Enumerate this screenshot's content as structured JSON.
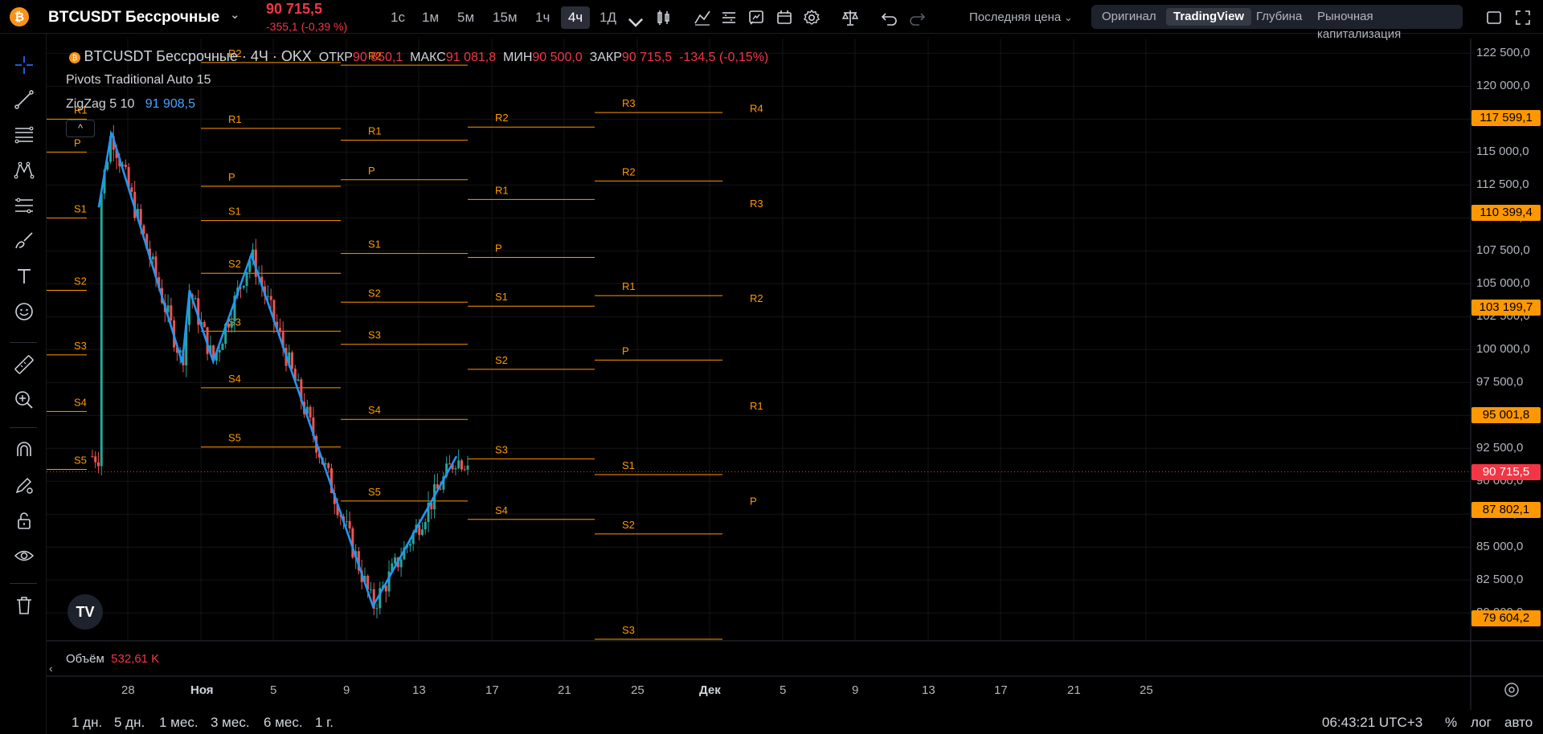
{
  "header": {
    "pair": "BTCUSDT Бессрочные",
    "last_price": "90 715,5",
    "change": "-355,1 (-0,39 %)",
    "timeframes": [
      "1с",
      "1м",
      "5м",
      "15м",
      "1ч",
      "4ч",
      "1Д"
    ],
    "active_timeframe": "4ч",
    "price_type": "Последняя цена",
    "views": [
      "Оригинал",
      "TradingView",
      "Глубина",
      "Рыночная капитализация"
    ],
    "active_view": "TradingView"
  },
  "legend": {
    "symbol": "BTCUSDT Бессрочные · 4Ч · OKX",
    "open_label": "ОТКР",
    "open": "90 850,1",
    "high_label": "МАКС",
    "high": "91 081,8",
    "low_label": "МИН",
    "low": "90 500,0",
    "close_label": "ЗАКР",
    "close": "90 715,5",
    "change": "-134,5 (-0,15%)",
    "pivots": "Pivots Traditional Auto 15",
    "zigzag": "ZigZag 5 10",
    "zigzag_value": "91 908,5",
    "collapse": "^"
  },
  "price_axis": {
    "ticks": [
      "122 500,0",
      "120 000,0",
      "117 500,0",
      "115 000,0",
      "112 500,0",
      "110 000,0",
      "107 500,0",
      "105 000,0",
      "102 500,0",
      "100 000,0",
      "97 500,0",
      "95 000,0",
      "92 500,0",
      "90 000,0",
      "87 500,0",
      "85 000,0",
      "82 500,0",
      "80 000,0"
    ],
    "badges": [
      {
        "text": "117 599,1",
        "price": 117599.1,
        "kind": "pivot"
      },
      {
        "text": "110 399,4",
        "price": 110399.4,
        "kind": "pivot"
      },
      {
        "text": "103 199,7",
        "price": 103199.7,
        "kind": "pivot"
      },
      {
        "text": "95 001,8",
        "price": 95001.8,
        "kind": "pivot"
      },
      {
        "text": "90 715,5",
        "price": 90715.5,
        "kind": "last"
      },
      {
        "text": "87 802,1",
        "price": 87802.1,
        "kind": "pivot"
      },
      {
        "text": "79 604,2",
        "price": 79604.2,
        "kind": "pivot"
      }
    ]
  },
  "time_axis": {
    "ticks": [
      {
        "label": "28",
        "bold": false
      },
      {
        "label": "Ноя",
        "bold": true
      },
      {
        "label": "5",
        "bold": false
      },
      {
        "label": "9",
        "bold": false
      },
      {
        "label": "13",
        "bold": false
      },
      {
        "label": "17",
        "bold": false
      },
      {
        "label": "21",
        "bold": false
      },
      {
        "label": "25",
        "bold": false
      },
      {
        "label": "Дек",
        "bold": true
      },
      {
        "label": "5",
        "bold": false
      },
      {
        "label": "9",
        "bold": false
      },
      {
        "label": "13",
        "bold": false
      },
      {
        "label": "17",
        "bold": false
      },
      {
        "label": "21",
        "bold": false
      },
      {
        "label": "25",
        "bold": false
      }
    ]
  },
  "volume": {
    "label": "Объём",
    "value": "532,61 K"
  },
  "bottom": {
    "ranges": [
      "1 дн.",
      "5 дн.",
      "1 мес.",
      "3 мес.",
      "6 мес.",
      "1 г."
    ],
    "clock": "06:43:21 UTC+3",
    "percent": "%",
    "log": "лог",
    "auto": "авто"
  },
  "chart_data": {
    "type": "candlestick",
    "y_range": [
      78000,
      123500
    ],
    "pivot_periods": [
      {
        "day_start": 0,
        "day_end": 1,
        "levels": [
          {
            "name": "R1",
            "price": 117500
          },
          {
            "name": "P",
            "price": 115000
          },
          {
            "name": "S1",
            "price": 110000
          },
          {
            "name": "S2",
            "price": 104500
          },
          {
            "name": "S3",
            "price": 99600
          },
          {
            "name": "S4",
            "price": 95300
          },
          {
            "name": "S5",
            "price": 90900
          }
        ]
      },
      {
        "day_start": 1,
        "day_end": 5,
        "levels": [
          {
            "name": "R2",
            "price": 121800
          },
          {
            "name": "R1",
            "price": 116800
          },
          {
            "name": "P",
            "price": 112400
          },
          {
            "name": "S1",
            "price": 109800
          },
          {
            "name": "S2",
            "price": 105800
          },
          {
            "name": "S3",
            "price": 101400
          },
          {
            "name": "S4",
            "price": 97100
          },
          {
            "name": "S5",
            "price": 92600
          }
        ]
      },
      {
        "day_start": 5,
        "day_end": 9,
        "levels": [
          {
            "name": "R2",
            "price": 121600
          },
          {
            "name": "R1",
            "price": 115900
          },
          {
            "name": "P",
            "price": 112900
          },
          {
            "name": "S1",
            "price": 107300
          },
          {
            "name": "S2",
            "price": 103600
          },
          {
            "name": "S3",
            "price": 100400
          },
          {
            "name": "S4",
            "price": 94700
          },
          {
            "name": "S5",
            "price": 88500
          }
        ]
      },
      {
        "day_start": 9,
        "day_end": 13,
        "levels": [
          {
            "name": "R2",
            "price": 116900
          },
          {
            "name": "R1",
            "price": 111400
          },
          {
            "name": "P",
            "price": 107000
          },
          {
            "name": "S1",
            "price": 103300
          },
          {
            "name": "S2",
            "price": 98500
          },
          {
            "name": "S3",
            "price": 91700
          },
          {
            "name": "S4",
            "price": 87100
          }
        ]
      },
      {
        "day_start": 13,
        "day_end": 17,
        "levels": [
          {
            "name": "R3",
            "price": 118000
          },
          {
            "name": "R2",
            "price": 112800
          },
          {
            "name": "R1",
            "price": 104100
          },
          {
            "name": "P",
            "price": 99200
          },
          {
            "name": "S1",
            "price": 90500
          },
          {
            "name": "S2",
            "price": 86000
          },
          {
            "name": "S3",
            "price": 78000
          }
        ]
      },
      {
        "day_start": 17,
        "day_end": 21,
        "levels": [
          {
            "name": "R4",
            "price": 117599.1
          },
          {
            "name": "R3",
            "price": 110399.4
          },
          {
            "name": "R2",
            "price": 103199.7
          },
          {
            "name": "R1",
            "price": 95001.8
          },
          {
            "name": "P",
            "price": 87802.1
          }
        ]
      }
    ],
    "zigzag": [
      {
        "day": -1.6,
        "price": 110800
      },
      {
        "day": -0.9,
        "price": 116500
      },
      {
        "day": 3.0,
        "price": 99000
      },
      {
        "day": 3.4,
        "price": 104500
      },
      {
        "day": 4.7,
        "price": 99100
      },
      {
        "day": 6.8,
        "price": 107200
      },
      {
        "day": 13.5,
        "price": 80500
      },
      {
        "day": 18.1,
        "price": 91900
      }
    ],
    "last_price": 90715.5
  }
}
